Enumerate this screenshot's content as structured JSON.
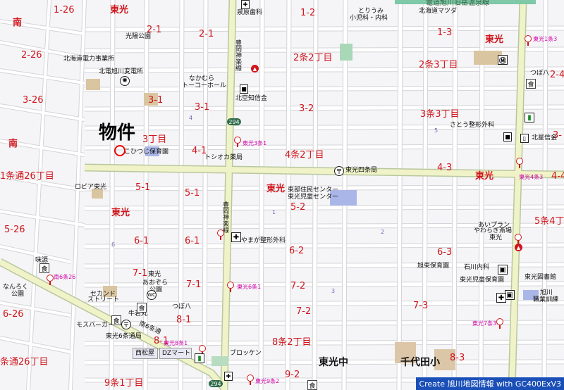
{
  "map": {
    "subject_label": "物件",
    "credit": "Create 旭川地図情報 with GC400ExV3",
    "top_label": "電道旭川旧岳温泉線",
    "area_labels": [
      {
        "t": "1-26"
      },
      {
        "t": "東光"
      },
      {
        "t": "1-2"
      },
      {
        "t": "南"
      },
      {
        "t": "2-1"
      },
      {
        "t": "2-1"
      },
      {
        "t": "1-3"
      },
      {
        "t": "東光"
      },
      {
        "t": "2-26"
      },
      {
        "t": "2条2丁目"
      },
      {
        "t": "2条3丁目"
      },
      {
        "t": "2-4"
      },
      {
        "t": "3-1"
      },
      {
        "t": "3-1"
      },
      {
        "t": "3-2"
      },
      {
        "t": "3-26"
      },
      {
        "t": "3条3丁目"
      },
      {
        "t": "南"
      },
      {
        "t": "3丁目"
      },
      {
        "t": "4-1"
      },
      {
        "t": "4条2丁目"
      },
      {
        "t": "3-"
      },
      {
        "t": "4-3"
      },
      {
        "t": "東光"
      },
      {
        "t": "4-4"
      },
      {
        "t": "1条通26丁目"
      },
      {
        "t": "5-1"
      },
      {
        "t": "5-1"
      },
      {
        "t": "東光"
      },
      {
        "t": "5-2"
      },
      {
        "t": "東光"
      },
      {
        "t": "5条4丁"
      },
      {
        "t": "5-26"
      },
      {
        "t": "6-1"
      },
      {
        "t": "6-1"
      },
      {
        "t": "6-2"
      },
      {
        "t": "6-3"
      },
      {
        "t": "7-1"
      },
      {
        "t": "7-1"
      },
      {
        "t": "7-2"
      },
      {
        "t": "6-26"
      },
      {
        "t": "7-2"
      },
      {
        "t": "7-3"
      },
      {
        "t": "8-1"
      },
      {
        "t": "8-1"
      },
      {
        "t": "8条2丁目"
      },
      {
        "t": "8-3"
      },
      {
        "t": "条通26丁目"
      },
      {
        "t": "9条1丁目"
      },
      {
        "t": "9-2"
      }
    ],
    "poi_labels": [
      {
        "t": "泉原歯科"
      },
      {
        "t": "とりうみ"
      },
      {
        "t": "小児科・内科"
      },
      {
        "t": "北海道マツダ"
      },
      {
        "t": "光陽公園"
      },
      {
        "t": "北海道電力事業所"
      },
      {
        "t": "北電旭川変電所"
      },
      {
        "t": "なかむら"
      },
      {
        "t": "トーコーホール"
      },
      {
        "t": "北空知信金"
      },
      {
        "t": "つぼ八"
      },
      {
        "t": "さとう整形外科"
      },
      {
        "t": "北星信金"
      },
      {
        "t": "こひつじ保育園"
      },
      {
        "t": "トシオカ薬局"
      },
      {
        "t": "東光四条局"
      },
      {
        "t": "ロピア東光"
      },
      {
        "t": "東部住民センター"
      },
      {
        "t": "東光児童センター"
      },
      {
        "t": "あいプラン"
      },
      {
        "t": "やわらぎ斎場"
      },
      {
        "t": "東光"
      },
      {
        "t": "やまが整形外科"
      },
      {
        "t": "味源"
      },
      {
        "t": "なんろく"
      },
      {
        "t": "公園"
      },
      {
        "t": "東光"
      },
      {
        "t": "あおぞら"
      },
      {
        "t": "公園"
      },
      {
        "t": "セカンド"
      },
      {
        "t": "ストリート"
      },
      {
        "t": "牛若丸"
      },
      {
        "t": "つぼ八"
      },
      {
        "t": "旭東保育園"
      },
      {
        "t": "石川内科"
      },
      {
        "t": "東光図書館"
      },
      {
        "t": "東光児童保育園"
      },
      {
        "t": "旭川"
      },
      {
        "t": "職業訓練"
      },
      {
        "t": "モスバーガー"
      },
      {
        "t": "東光6条通局"
      },
      {
        "t": "西松屋"
      },
      {
        "t": "DZマート"
      },
      {
        "t": "ブロッケン"
      },
      {
        "t": "東光中"
      },
      {
        "t": "千代田小"
      },
      {
        "t": "南6条通"
      },
      {
        "t": "豊岡神楽線"
      },
      {
        "t": "豊岡神楽線"
      }
    ],
    "bus_stops": [
      {
        "t": "東光1条3"
      },
      {
        "t": "東光3条1"
      },
      {
        "t": "東光4条3"
      },
      {
        "t": "南6条26"
      },
      {
        "t": "東光6条1"
      },
      {
        "t": "東光7条3"
      },
      {
        "t": "東光8条1"
      },
      {
        "t": "東光9条2"
      }
    ],
    "route_numbers": [
      {
        "t": "294"
      },
      {
        "t": "294"
      }
    ],
    "block_numbers": [
      "1",
      "2",
      "3",
      "4",
      "5",
      "6",
      "7",
      "8",
      "9",
      "10",
      "11",
      "12"
    ]
  }
}
